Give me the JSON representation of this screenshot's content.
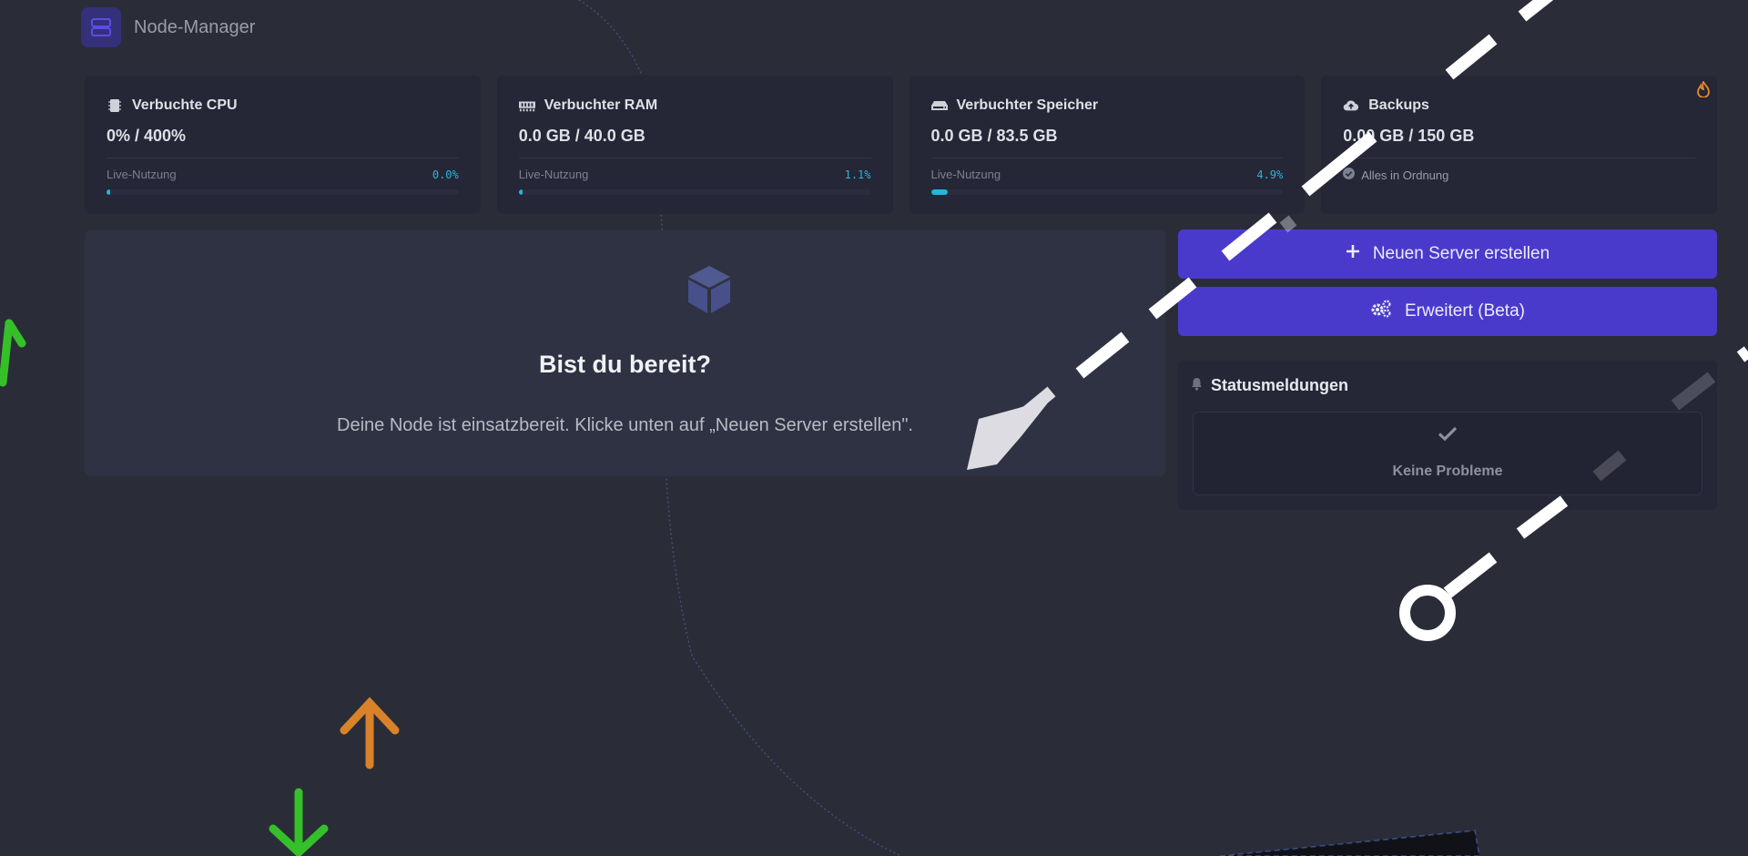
{
  "app": {
    "name": "Node-Manager"
  },
  "stats": [
    {
      "icon": "cpu-icon",
      "label": "Verbuchte CPU",
      "value": "0% / 400%",
      "foot_label": "Live-Nutzung",
      "percent_text": "0.0%",
      "percent": 0.0
    },
    {
      "icon": "ram-icon",
      "label": "Verbuchter RAM",
      "value": "0.0 GB / 40.0 GB",
      "foot_label": "Live-Nutzung",
      "percent_text": "1.1%",
      "percent": 1.1
    },
    {
      "icon": "storage-icon",
      "label": "Verbuchter Speicher",
      "value": "0.0 GB / 83.5 GB",
      "foot_label": "Live-Nutzung",
      "percent_text": "4.9%",
      "percent": 4.9
    },
    {
      "icon": "cloud-upload-icon",
      "label": "Backups",
      "value": "0.00 GB / 150 GB",
      "status_text": "Alles in Ordnung"
    }
  ],
  "welcome": {
    "icon": "cube-icon",
    "title": "Bist du bereit?",
    "text": "Deine Node ist einsatzbereit. Klicke unten auf „Neuen Server erstellen\"."
  },
  "actions": {
    "new_server": {
      "label": "Neuen Server erstellen",
      "icon": "plus-icon"
    },
    "advanced": {
      "label": "Erweitert (Beta)",
      "icon": "gears-icon"
    }
  },
  "status": {
    "title": "Statusmeldungen",
    "icon": "bell-icon",
    "empty_icon": "check-icon",
    "empty_text": "Keine Probleme"
  },
  "colors": {
    "background": "#2a2d38",
    "card": "#252636",
    "accent": "#4a3acb",
    "usage": "#22b6db",
    "flame": "#e8892a",
    "arrow_green": "#35c02a",
    "arrow_orange": "#d9822a"
  }
}
